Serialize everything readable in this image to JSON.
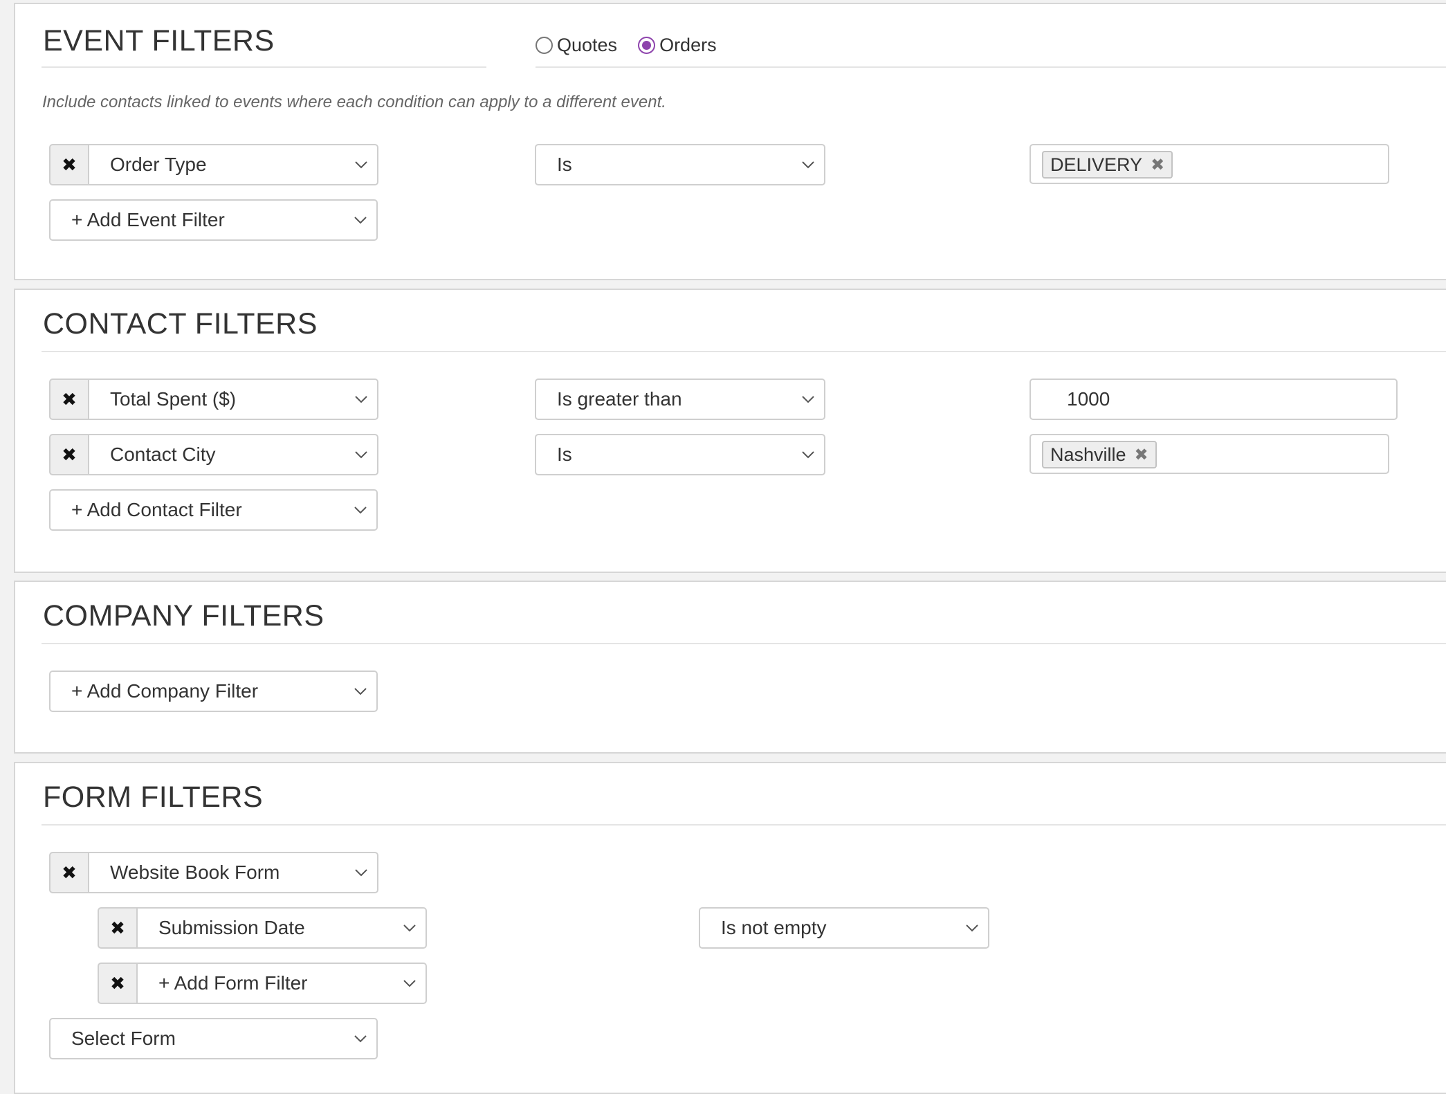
{
  "event_filters": {
    "title": "EVENT FILTERS",
    "radios": [
      {
        "label": "Quotes",
        "selected": false
      },
      {
        "label": "Orders",
        "selected": true
      }
    ],
    "note": "Include contacts linked to events where each condition can apply to a different event.",
    "row1": {
      "field": "Order Type",
      "operator": "Is",
      "tag": "DELIVERY"
    },
    "add_label": "+ Add Event Filter"
  },
  "contact_filters": {
    "title": "CONTACT FILTERS",
    "row1": {
      "field": "Total Spent ($)",
      "operator": "Is greater than",
      "value": "1000"
    },
    "row2": {
      "field": "Contact City",
      "operator": "Is",
      "tag": "Nashville"
    },
    "add_label": "+ Add Contact Filter"
  },
  "company_filters": {
    "title": "COMPANY FILTERS",
    "add_label": "+ Add Company Filter"
  },
  "form_filters": {
    "title": "FORM FILTERS",
    "form_row": {
      "field": "Website Book Form"
    },
    "sub_row1": {
      "field": "Submission Date",
      "operator": "Is not empty"
    },
    "sub_row2": {
      "field": "+ Add Form Filter"
    },
    "select_form_label": "Select Form"
  },
  "icons": {
    "remove": "✖",
    "tag_remove": "✖",
    "dropdown": "chevron-down-icon"
  },
  "colors": {
    "radio_accent": "#8e44ad",
    "panel_border": "#d6d6d6",
    "page_bg": "#f2f2f2"
  }
}
